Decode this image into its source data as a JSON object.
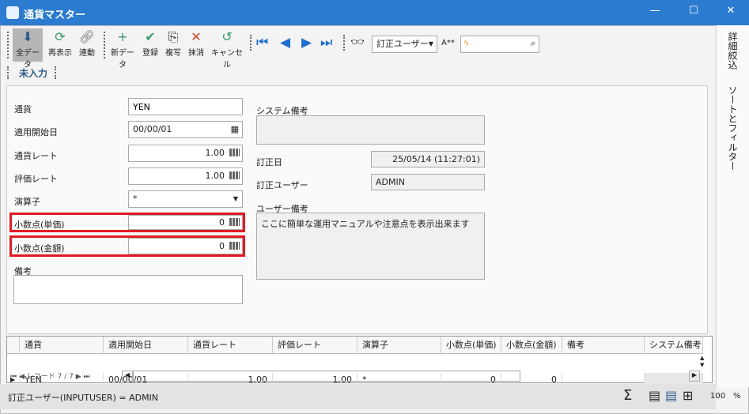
{
  "window": {
    "title": "通貨マスター",
    "minimize": "—",
    "maximize": "☐",
    "close": "✕"
  },
  "toolbar": {
    "all_data": "全データ",
    "refresh": "再表示",
    "link": "連動",
    "new": "新データ",
    "save": "登録",
    "copy": "複写",
    "delete": "抹消",
    "cancel": "キャンセル",
    "search_field": "訂正ユーザー",
    "search_mode": "A**",
    "search_value": "",
    "unentered": "未入力"
  },
  "form": {
    "currency_label": "通貨",
    "currency": "YEN",
    "start_date_label": "適用開始日",
    "start_date": "00/00/01",
    "rate_label": "通貨レート",
    "rate": "1.00",
    "eval_rate_label": "評価レート",
    "eval_rate": "1.00",
    "operator_label": "演算子",
    "operator": "*",
    "dec_unit_label": "小数点(単価)",
    "dec_unit": "0",
    "dec_amount_label": "小数点(金額)",
    "dec_amount": "0",
    "note_label": "備考",
    "note": "",
    "system_note_label": "システム備考",
    "system_note": "",
    "modified_date_label": "訂正日",
    "modified_date": "25/05/14 (11:27:01)",
    "modified_user_label": "訂正ユーザー",
    "modified_user": "ADMIN",
    "user_note_label": "ユーザー備考",
    "user_note": "ここに簡単な運用マニュアルや注意点を表示出来ます"
  },
  "grid": {
    "columns": [
      "通貨",
      "適用開始日",
      "通貨レート",
      "評価レート",
      "演算子",
      "小数点(単価)",
      "小数点(金額)",
      "備考",
      "システム備考"
    ],
    "rows": [
      [
        "YEN",
        "00/00/01",
        "1.00",
        "1.00",
        "*",
        "0",
        "0",
        "",
        ""
      ]
    ],
    "record_nav": "レコード 7 / 7"
  },
  "status": {
    "filter": "訂正ユーザー(INPUTUSER) = ADMIN",
    "zoom": "100",
    "percent": "%",
    "sigma": "Σ"
  },
  "side": {
    "detail_filter": "詳細絞込",
    "sort_filter": "ソートとフィルター"
  },
  "colors": {
    "title_bar": "#2b7bd0",
    "highlight": "#e01b24"
  }
}
